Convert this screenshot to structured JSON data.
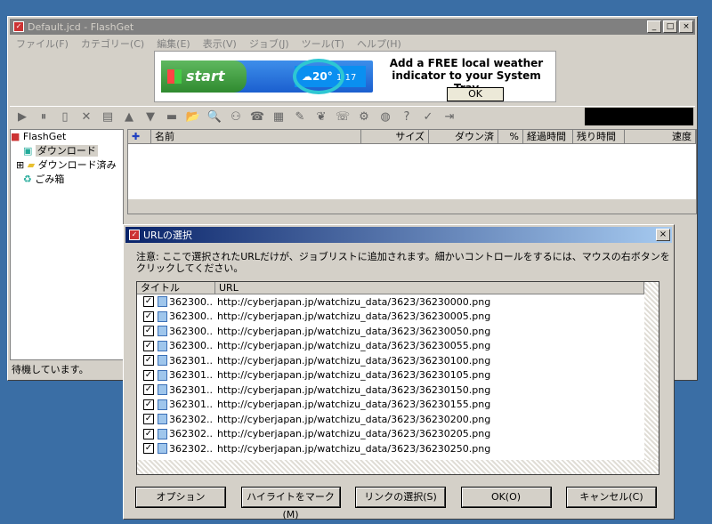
{
  "window": {
    "title": "Default.jcd - FlashGet",
    "min": "_",
    "max": "□",
    "close": "×"
  },
  "menu": [
    "ファイル(F)",
    "カテゴリー(C)",
    "編集(E)",
    "表示(V)",
    "ジョブ(J)",
    "ツール(T)",
    "ヘルプ(H)"
  ],
  "ad": {
    "start_label": "start",
    "temp": "20°",
    "time": "1:17",
    "text": "Add a FREE local weather indicator to your System Tray",
    "ok": "OK"
  },
  "tree": {
    "root": "FlashGet",
    "items": [
      "ダウンロード",
      "ダウンロード済み",
      "ごみ箱"
    ]
  },
  "list": {
    "columns": [
      "名前",
      "サイズ",
      "ダウン済",
      "%",
      "経過時間",
      "残り時間",
      "速度"
    ]
  },
  "status": "待機しています。",
  "dialog": {
    "title": "URLの選択",
    "note": "注意: ここで選択されたURLだけが、ジョブリストに追加されます。細かいコントロールをするには、マウスの右ボタンをクリックしてください。",
    "columns": [
      "タイトル",
      "URL"
    ],
    "rows": [
      {
        "t": "362300...",
        "u": "http://cyberjapan.jp/watchizu_data/3623/36230000.png"
      },
      {
        "t": "362300...",
        "u": "http://cyberjapan.jp/watchizu_data/3623/36230005.png"
      },
      {
        "t": "362300...",
        "u": "http://cyberjapan.jp/watchizu_data/3623/36230050.png"
      },
      {
        "t": "362300...",
        "u": "http://cyberjapan.jp/watchizu_data/3623/36230055.png"
      },
      {
        "t": "362301...",
        "u": "http://cyberjapan.jp/watchizu_data/3623/36230100.png"
      },
      {
        "t": "362301...",
        "u": "http://cyberjapan.jp/watchizu_data/3623/36230105.png"
      },
      {
        "t": "362301...",
        "u": "http://cyberjapan.jp/watchizu_data/3623/36230150.png"
      },
      {
        "t": "362301...",
        "u": "http://cyberjapan.jp/watchizu_data/3623/36230155.png"
      },
      {
        "t": "362302...",
        "u": "http://cyberjapan.jp/watchizu_data/3623/36230200.png"
      },
      {
        "t": "362302...",
        "u": "http://cyberjapan.jp/watchizu_data/3623/36230205.png"
      },
      {
        "t": "362302...",
        "u": "http://cyberjapan.jp/watchizu_data/3623/36230250.png"
      }
    ],
    "buttons": [
      "オプション",
      "ハイライトをマーク(M)",
      "リンクの選択(S)",
      "OK(O)",
      "キャンセル(C)"
    ]
  }
}
